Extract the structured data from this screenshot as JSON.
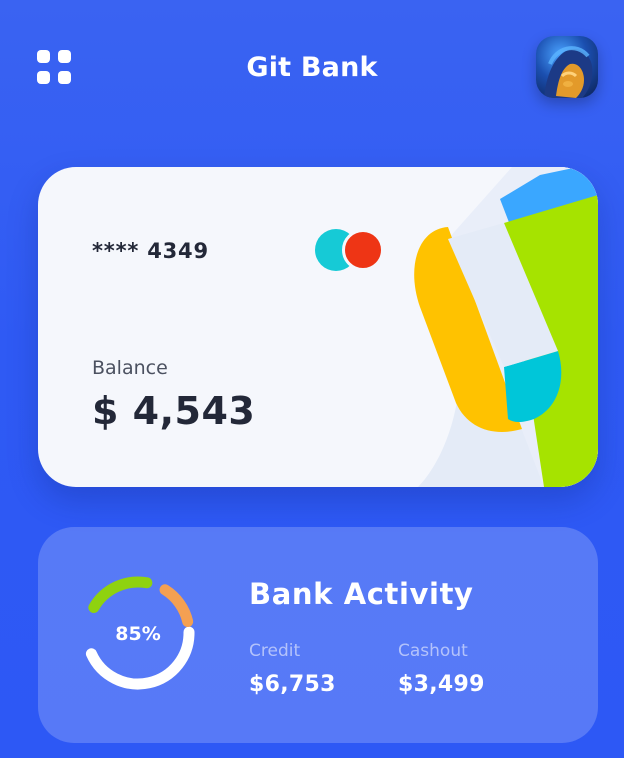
{
  "header": {
    "title": "Git Bank",
    "menu_icon": "grid-menu-icon",
    "avatar_icon": "user-avatar"
  },
  "card": {
    "number": "**** 4349",
    "balance_label": "Balance",
    "balance_value": "$ 4,543",
    "logo_colors": [
      "#16cad6",
      "#ee3515"
    ],
    "art_colors": [
      "#ffc200",
      "#a6e300",
      "#00c6d9",
      "#3aa7ff",
      "#e4ebf7"
    ]
  },
  "activity": {
    "title": "Bank Activity",
    "percent_label": "85%",
    "percent_value": 0.85,
    "ring_colors": [
      "#8fd20f",
      "#f4a052",
      "#ffffff"
    ],
    "credit_label": "Credit",
    "credit_value": "$6,753",
    "cashout_label": "Cashout",
    "cashout_value": "$3,499"
  },
  "colors": {
    "background": "#2f5af4",
    "card_bg": "#f5f7fc",
    "text_dark": "#232838"
  }
}
